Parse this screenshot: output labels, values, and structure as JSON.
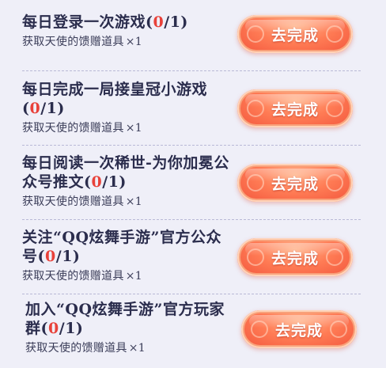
{
  "tasks": [
    {
      "title": "每日登录一次游戏",
      "progress_open": "(",
      "progress_current": "0",
      "progress_rest": "/1)",
      "reward_text": "获取天使的馈赠道具",
      "reward_multiplier": "×1",
      "button_label": "去完成"
    },
    {
      "title": "每日完成一局接皇冠小游戏",
      "progress_open": "(",
      "progress_current": "0",
      "progress_rest": "/1)",
      "reward_text": "获取天使的馈赠道具",
      "reward_multiplier": "×1",
      "button_label": "去完成"
    },
    {
      "title": "每日阅读一次稀世-为你加冕公众号推文",
      "progress_open": "(",
      "progress_current": "0",
      "progress_rest": "/1)",
      "reward_text": "获取天使的馈赠道具",
      "reward_multiplier": "×1",
      "button_label": "去完成"
    },
    {
      "title": "关注“QQ炫舞手游”官方公众号",
      "progress_open": "(",
      "progress_current": "0",
      "progress_rest": "/1)",
      "reward_text": "获取天使的馈赠道具",
      "reward_multiplier": "×1",
      "button_label": "去完成"
    },
    {
      "title": "加入“QQ炫舞手游”官方玩家群",
      "progress_open": "(",
      "progress_current": "0",
      "progress_rest": "/1)",
      "reward_text": "获取天使的馈赠道具",
      "reward_multiplier": "×1",
      "button_label": "去完成"
    }
  ],
  "colors": {
    "background": "#efeff8",
    "text": "#2b2d4d",
    "progress_highlight": "#e8413a",
    "button": "#f2553c",
    "button_text": "#ffffff"
  }
}
